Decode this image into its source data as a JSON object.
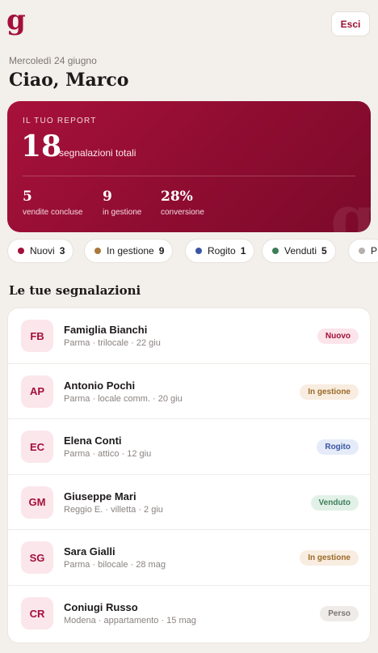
{
  "header": {
    "logo": "g",
    "logout_label": "Esci"
  },
  "greeting": {
    "date": "Mercoledì 24 giugno",
    "title": "Ciao, Marco"
  },
  "report": {
    "label": "IL TUO REPORT",
    "total": "18",
    "total_label": "segnalazioni totali",
    "watermark": "g",
    "stats": [
      {
        "value": "5",
        "label": "vendite concluse"
      },
      {
        "value": "9",
        "label": "in gestione"
      },
      {
        "value": "28%",
        "label": "conversione"
      }
    ]
  },
  "filters": [
    {
      "label": "Nuovi",
      "count": "3",
      "color": "#a3103a"
    },
    {
      "label": "In gestione",
      "count": "9",
      "color": "#a9783b"
    },
    {
      "label": "Rogito",
      "count": "1",
      "color": "#3b56a4"
    },
    {
      "label": "Venduti",
      "count": "5",
      "color": "#3d7d58"
    },
    {
      "label": "P",
      "count": "",
      "color": "#b5b0ac"
    }
  ],
  "list": {
    "title": "Le tue segnalazioni",
    "items": [
      {
        "initials": "FB",
        "name": "Famiglia Bianchi",
        "meta": "Parma · trilocale · 22 giu",
        "status": "Nuovo"
      },
      {
        "initials": "AP",
        "name": "Antonio Pochi",
        "meta": "Parma · locale comm. · 20 giu",
        "status": "In gestione"
      },
      {
        "initials": "EC",
        "name": "Elena Conti",
        "meta": "Parma · attico · 12 giu",
        "status": "Rogito"
      },
      {
        "initials": "GM",
        "name": "Giuseppe Mari",
        "meta": "Reggio E. · villetta · 2 giu",
        "status": "Venduto"
      },
      {
        "initials": "SG",
        "name": "Sara Gialli",
        "meta": "Parma · bilocale · 28 mag",
        "status": "In gestione"
      },
      {
        "initials": "CR",
        "name": "Coniugi Russo",
        "meta": "Modena · appartamento · 15 mag",
        "status": "Perso"
      }
    ]
  }
}
